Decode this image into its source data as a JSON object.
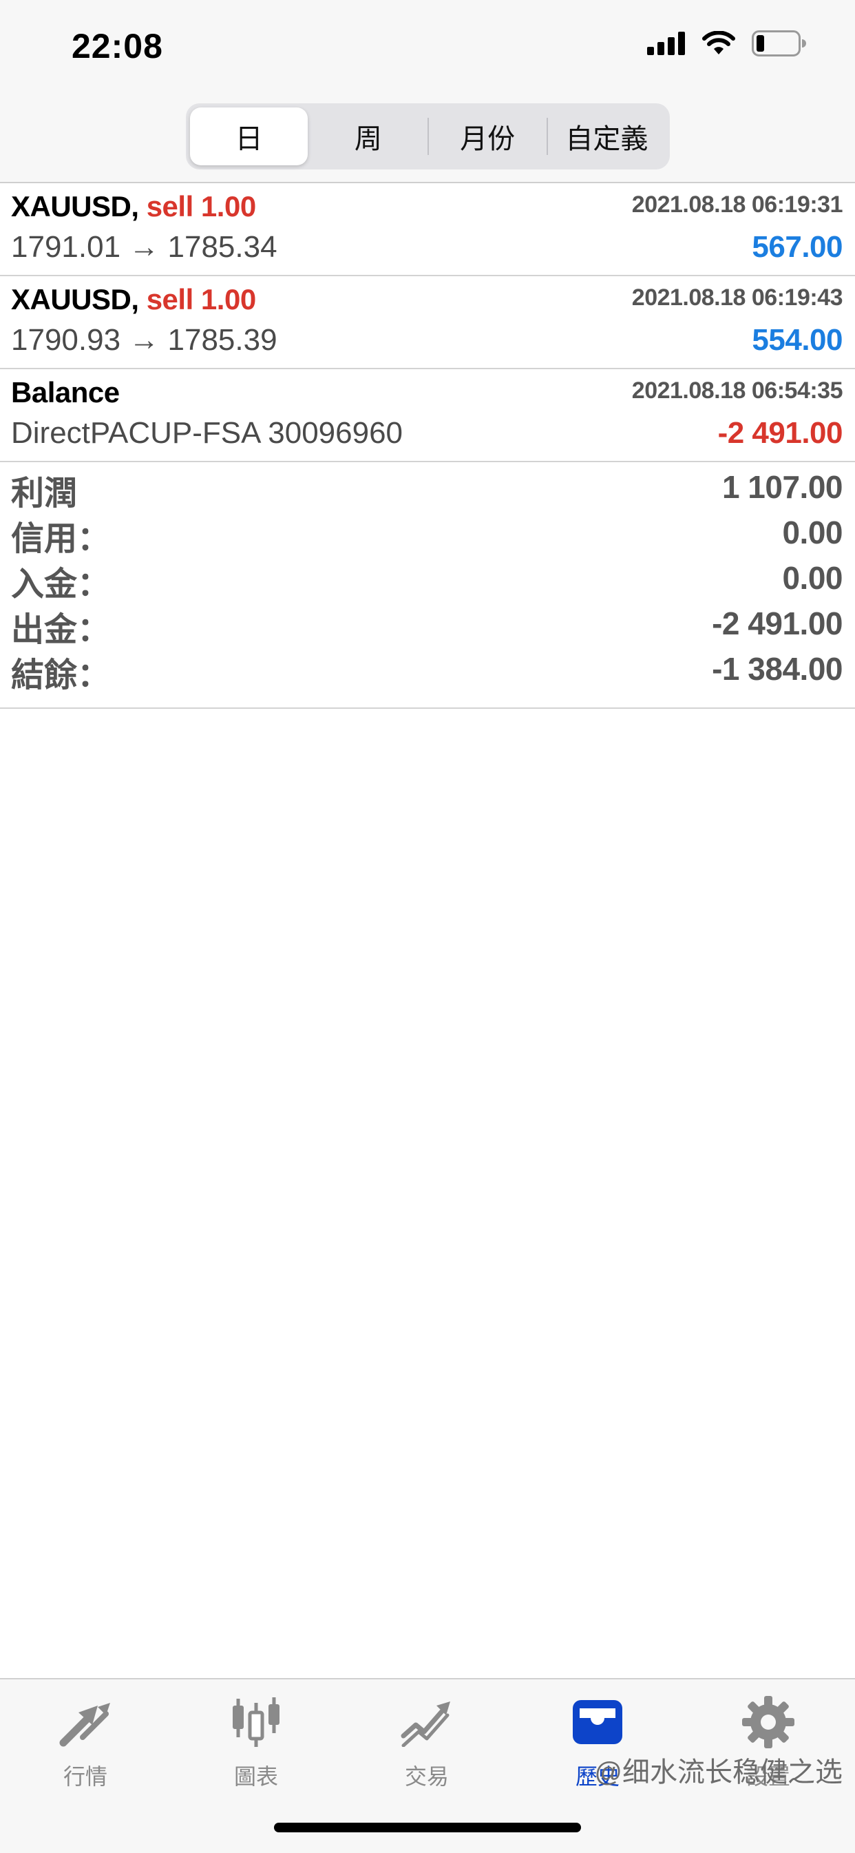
{
  "status_bar": {
    "time": "22:08"
  },
  "segments": [
    {
      "label": "日",
      "selected": true
    },
    {
      "label": "周",
      "selected": false
    },
    {
      "label": "月份",
      "selected": false
    },
    {
      "label": "自定義",
      "selected": false
    }
  ],
  "deals": [
    {
      "symbol": "XAUUSD,",
      "side": "sell 1.00",
      "time": "2021.08.18 06:19:31",
      "prices": "1791.01 → 1785.34",
      "profit": "567.00",
      "profit_color": "#1b7ee0"
    },
    {
      "symbol": "XAUUSD,",
      "side": "sell 1.00",
      "time": "2021.08.18 06:19:43",
      "prices": "1790.93 → 1785.39",
      "profit": "554.00",
      "profit_color": "#1b7ee0"
    },
    {
      "symbol": "Balance",
      "side": "",
      "time": "2021.08.18 06:54:35",
      "prices": "DirectPACUP-FSA 30096960",
      "profit": "-2 491.00",
      "profit_color": "#d8362c"
    }
  ],
  "summary": [
    {
      "label": "利潤",
      "value": "1 107.00"
    },
    {
      "label": "信用：",
      "value": "0.00"
    },
    {
      "label": "入金：",
      "value": "0.00"
    },
    {
      "label": "出金：",
      "value": "-2 491.00"
    },
    {
      "label": "結餘：",
      "value": "-1 384.00"
    }
  ],
  "tabbar": [
    {
      "label": "行情",
      "icon": "quotes-arrows-icon",
      "active": false
    },
    {
      "label": "圖表",
      "icon": "candlestick-chart-icon",
      "active": false
    },
    {
      "label": "交易",
      "icon": "trade-trend-icon",
      "active": false
    },
    {
      "label": "歷史",
      "icon": "history-inbox-icon",
      "active": true
    },
    {
      "label": "設置",
      "icon": "gear-icon",
      "active": false
    }
  ],
  "watermark": "@细水流长稳健之选",
  "colors": {
    "accent_blue": "#0d44c9",
    "profit_blue": "#1b7ee0",
    "loss_red": "#d8362c"
  }
}
